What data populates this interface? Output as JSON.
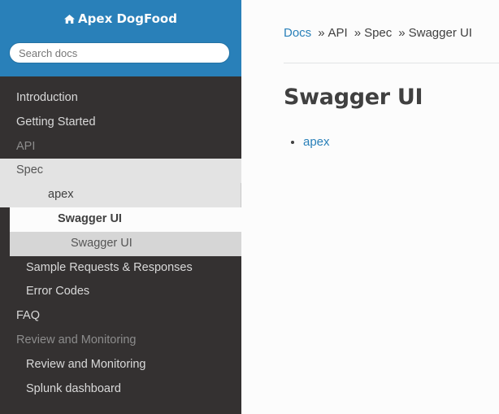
{
  "brand": {
    "title": "Apex DogFood",
    "icon": "home-icon"
  },
  "search": {
    "placeholder": "Search docs"
  },
  "sidebar": {
    "items": [
      {
        "label": "Introduction"
      },
      {
        "label": "Getting Started"
      },
      {
        "label": "API"
      },
      {
        "label": "Spec"
      },
      {
        "label": "apex"
      },
      {
        "label": "Swagger UI"
      },
      {
        "label": "Swagger UI"
      },
      {
        "label": "Sample Requests & Responses"
      },
      {
        "label": "Error Codes"
      },
      {
        "label": "FAQ"
      },
      {
        "label": "Review and Monitoring"
      },
      {
        "label": "Review and Monitoring"
      },
      {
        "label": "Splunk dashboard"
      }
    ]
  },
  "breadcrumb": {
    "docs": "Docs",
    "sep1": "»",
    "api": "API",
    "sep2": "»",
    "spec": "Spec",
    "sep3": "»",
    "current": "Swagger UI"
  },
  "main": {
    "title": "Swagger UI",
    "links": [
      "apex"
    ]
  },
  "colors": {
    "sidebar_bg": "#343131",
    "brand_bg": "#2980b9",
    "link": "#2980b9",
    "text": "#404040"
  }
}
